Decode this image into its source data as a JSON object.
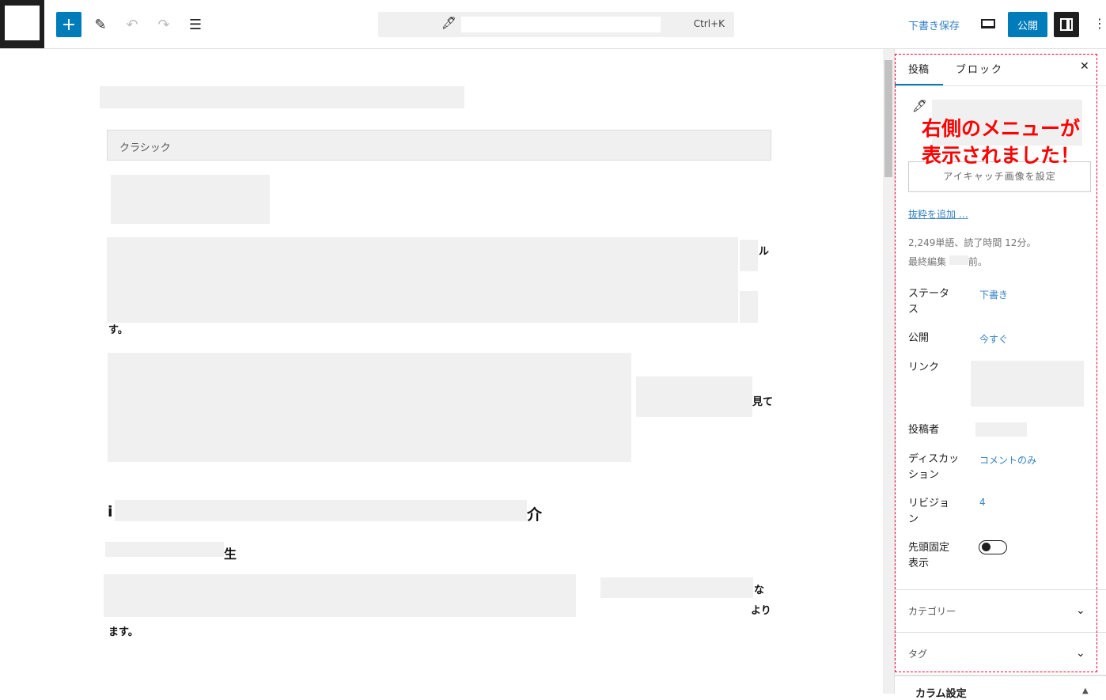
{
  "toolbar": {
    "add": "+",
    "pen": "✎",
    "undo": "↶",
    "redo": "↷",
    "list": "☰",
    "shortcut": "Ctrl+K",
    "save_draft": "下書き保存",
    "publish": "公開",
    "more": "⋮"
  },
  "editor": {
    "classic_label": "クラシック",
    "frag1": "ル",
    "frag2": "す。",
    "frag3": "見て",
    "frag4": "ι",
    "heading1_start": "i",
    "heading1_end": "介",
    "heading2_end": "生",
    "frag5": "な",
    "frag6": "より",
    "frag7": "ます。"
  },
  "sidebar": {
    "tab_post": "投稿",
    "tab_block": "ブロック",
    "close": "✕",
    "featured_image": "アイキャッチ画像を設定",
    "add_excerpt": "抜粋を追加 …",
    "word_count": "2,249単語、読了時間 12分。",
    "last_edited_prefix": "最終編集",
    "last_edited_suffix": "前。",
    "rows": [
      {
        "label": "ステータス",
        "value": "下書き"
      },
      {
        "label": "公開",
        "value": "今すぐ"
      },
      {
        "label": "リンク",
        "value": ""
      },
      {
        "label": "投稿者",
        "value": ""
      },
      {
        "label": "ディスカッション",
        "value": "コメントのみ"
      },
      {
        "label": "リビジョン",
        "value": "4"
      },
      {
        "label": "先頭固定表示",
        "value": ""
      }
    ],
    "sticky_on": false,
    "panels": [
      "カテゴリー",
      "タグ",
      "カラム設定"
    ]
  },
  "annotation": {
    "line1": "右側のメニューが",
    "line2": "表示されました！"
  },
  "colors": {
    "accent": "#007cba",
    "annotation": "#ff0000"
  }
}
